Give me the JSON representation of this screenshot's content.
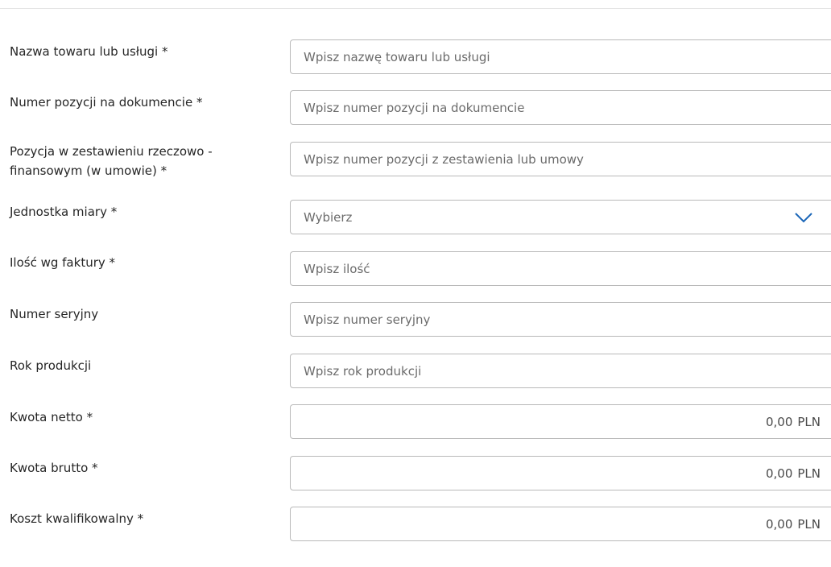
{
  "fields": [
    {
      "label": "Nazwa towaru lub usługi *",
      "placeholder": "Wpisz nazwę towaru lub usługi"
    },
    {
      "label": "Numer pozycji na dokumencie *",
      "placeholder": "Wpisz numer pozycji na dokumencie"
    },
    {
      "label": "Pozycja w zestawieniu rzeczowo - finansowym (w umowie) *",
      "placeholder": "Wpisz numer pozycji z zestawienia lub umowy"
    },
    {
      "label": "Jednostka miary *",
      "selected": "Wybierz"
    },
    {
      "label": "Ilość wg faktury  *",
      "placeholder": "Wpisz ilość"
    },
    {
      "label": "Numer seryjny",
      "placeholder": "Wpisz numer seryjny"
    },
    {
      "label": "Rok produkcji",
      "placeholder": "Wpisz rok produkcji"
    },
    {
      "label": "Kwota netto  *",
      "amount": "0,00",
      "currency": "PLN"
    },
    {
      "label": "Kwota brutto  *",
      "amount": "0,00",
      "currency": "PLN"
    },
    {
      "label": "Koszt kwalifikowalny  *",
      "amount": "0,00",
      "currency": "PLN"
    }
  ],
  "colors": {
    "border": "#b9b9b9",
    "chevron": "#1a66b8",
    "text": "#262626",
    "placeholder": "#6b6b6b"
  },
  "icons": {
    "select_chevron": "chevron-down-icon"
  }
}
